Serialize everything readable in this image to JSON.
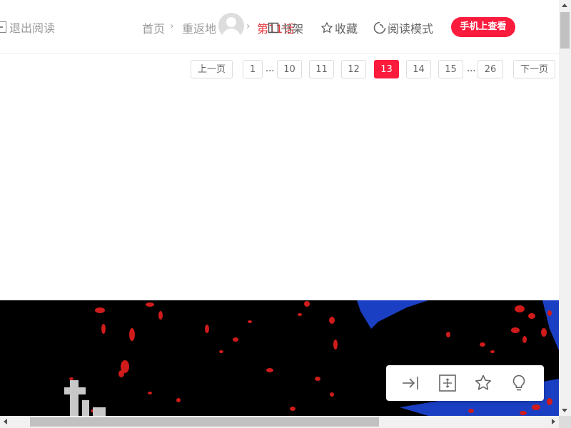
{
  "header": {
    "exit_label": "退出阅读",
    "breadcrumb": {
      "home": "首页",
      "series": "重返地",
      "chapter": "第11话"
    },
    "overlap_text": "书架一回 收藏",
    "tools": {
      "bookshelf_label": "书架",
      "favorite_label": "收藏",
      "read_mode_label": "阅读模式"
    },
    "mobile_button": "手机上查看"
  },
  "pagination": {
    "prev_label": "上一页",
    "next_label": "下一页",
    "pages": [
      "1",
      "10",
      "11",
      "12",
      "13",
      "14",
      "15",
      "26"
    ],
    "current": "13",
    "ellipsis": "..."
  },
  "float_toolbar": {
    "icons": [
      "collapse-right-icon",
      "expand-icon",
      "star-icon",
      "lightbulb-icon"
    ]
  },
  "colors": {
    "accent": "#fb1b3c",
    "breadcrumb_active": "#e8343a"
  }
}
